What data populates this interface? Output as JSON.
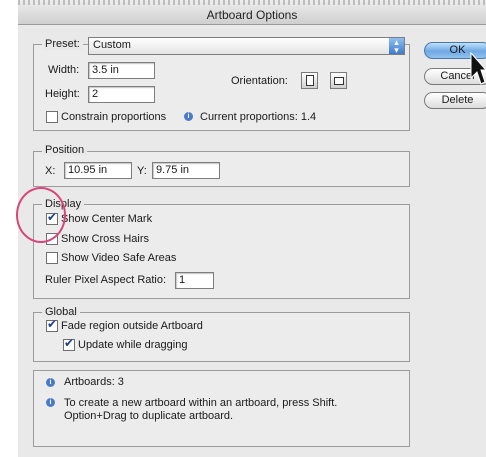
{
  "window": {
    "title": "Artboard Options"
  },
  "preset": {
    "label": "Preset:",
    "value": "Custom"
  },
  "size": {
    "width_label": "Width:",
    "width_value": "3.5 in",
    "height_label": "Height:",
    "height_value": "2"
  },
  "orientation": {
    "label": "Orientation:"
  },
  "constrain": {
    "label": "Constrain proportions",
    "checked": false
  },
  "proportions": {
    "text": "Current proportions: 1.4"
  },
  "position": {
    "legend": "Position",
    "x_label": "X:",
    "x_value": "10.95 in",
    "y_label": "Y:",
    "y_value": "9.75 in"
  },
  "display": {
    "legend": "Display",
    "show_center_mark": "Show Center Mark",
    "show_cross_hairs": "Show Cross Hairs",
    "show_video_safe": "Show Video Safe Areas",
    "ruler_label": "Ruler Pixel Aspect Ratio:",
    "ruler_value": "1"
  },
  "global": {
    "legend": "Global",
    "fade": "Fade region outside Artboard",
    "update": "Update while dragging"
  },
  "info": {
    "artboards": "Artboards: 3",
    "tip_line1": "To create a new artboard within an artboard, press Shift.",
    "tip_line2": "Option+Drag to duplicate artboard."
  },
  "buttons": {
    "ok": "OK",
    "cancel": "Cancel",
    "delete": "Delete"
  },
  "colors": {
    "accent": "#4a7bc8",
    "highlight": "#d8457a"
  }
}
